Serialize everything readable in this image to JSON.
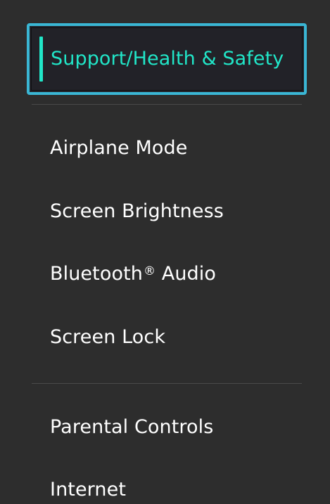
{
  "menu": {
    "selected": {
      "label": "Support/Health & Safety"
    },
    "items": [
      {
        "label": "Airplane Mode"
      },
      {
        "label": "Screen Brightness"
      },
      {
        "label": "Bluetooth",
        "mark": "®",
        "suffix": " Audio"
      },
      {
        "label": "Screen Lock"
      },
      {
        "label": "Parental Controls"
      },
      {
        "label": "Internet"
      }
    ]
  },
  "colors": {
    "background": "#2d2d2d",
    "selection_border": "#3ab6d4",
    "selection_text": "#21e6c8",
    "text": "#ffffff",
    "divider": "#4a4a4a"
  }
}
